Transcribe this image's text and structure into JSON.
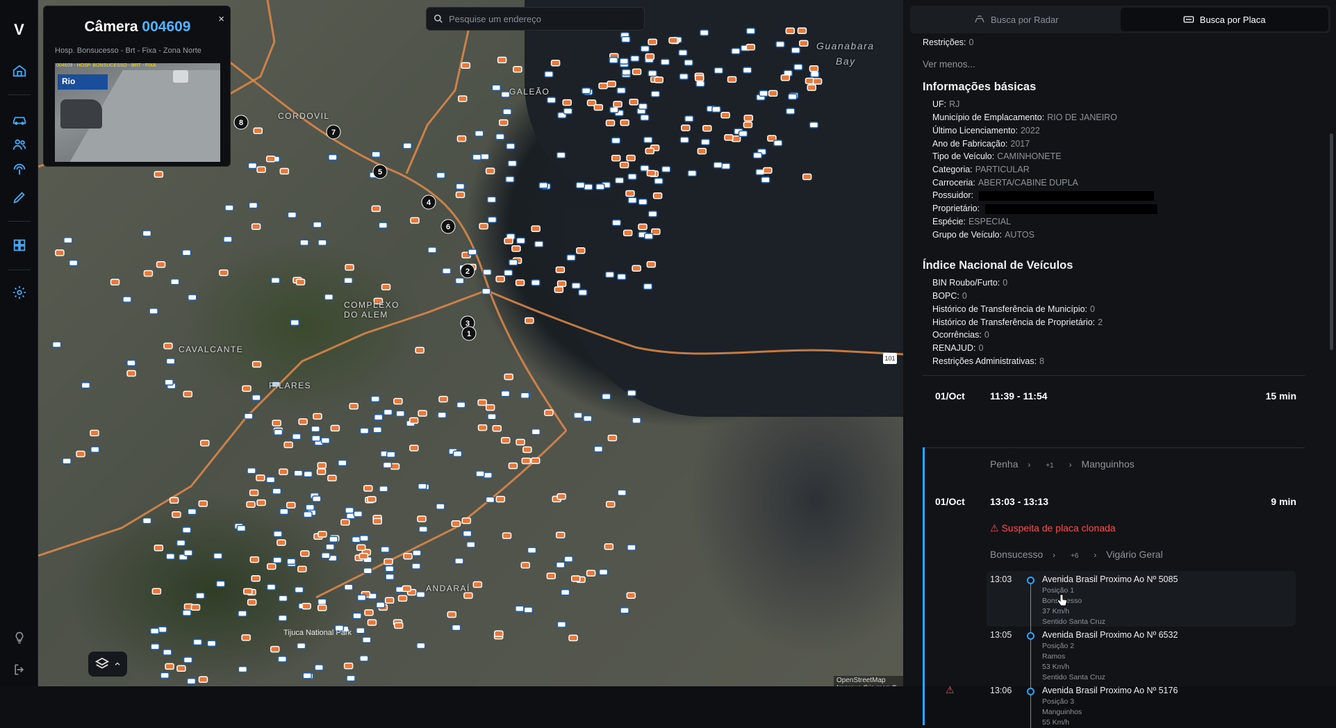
{
  "app": {
    "logo": "V"
  },
  "search": {
    "placeholder": "Pesquise um endereço"
  },
  "camera_card": {
    "title_prefix": "Câmera",
    "camera_id": "004609",
    "subtitle": "Hosp. Bonsucesso - Brt - Fixa - Zona Norte",
    "overlay_text": "004609 - HOSP. BONSUCESSO - BRT - FIXA",
    "logo_text": "Rio",
    "close_label": "×"
  },
  "map": {
    "labels": [
      "Guanabara",
      "Bay",
      "GALEÃO",
      "CORDOVIL",
      "COMPLEXO",
      "DO ALEM",
      "CAVALCANTE",
      "PILARES",
      "ANDARAÍ",
      "Tijuca National Park"
    ],
    "markers": [
      "8",
      "7",
      "5",
      "4",
      "6",
      "2",
      "3",
      "1"
    ],
    "highway_shield": "101",
    "attribution": "OpenStreetMap Improve this map © Maxar"
  },
  "tabs": [
    {
      "label": "Busca por Radar",
      "icon": "radar-icon",
      "active": false
    },
    {
      "label": "Busca por Placa",
      "icon": "plate-icon",
      "active": true
    }
  ],
  "panel": {
    "restricoes_top": {
      "key": "Restrições:",
      "value": "0"
    },
    "ver_menos": "Ver menos...",
    "basic_title": "Informações básicas",
    "basic": [
      {
        "key": "UF:",
        "value": "RJ"
      },
      {
        "key": "Município de Emplacamento:",
        "value": "RIO DE JANEIRO"
      },
      {
        "key": "Último Licenciamento:",
        "value": "2022"
      },
      {
        "key": "Ano de Fabricação:",
        "value": "2017"
      },
      {
        "key": "Tipo de Veículo:",
        "value": "CAMINHONETE"
      },
      {
        "key": "Categoria:",
        "value": "PARTICULAR"
      },
      {
        "key": "Carroceria:",
        "value": "ABERTA/CABINE DUPLA"
      },
      {
        "key": "Possuidor:",
        "value": ""
      },
      {
        "key": "Proprietário:",
        "value": ""
      },
      {
        "key": "Espécie:",
        "value": "ESPECIAL"
      },
      {
        "key": "Grupo de Veículo:",
        "value": "AUTOS"
      }
    ],
    "inv_title": "Índice Nacional de Veículos",
    "inv": [
      {
        "key": "BIN Roubo/Furto:",
        "value": "0"
      },
      {
        "key": "BOPC:",
        "value": "0"
      },
      {
        "key": "Histórico de Transferência de Município:",
        "value": "0"
      },
      {
        "key": "Histórico de Transferência de Proprietário:",
        "value": "2"
      },
      {
        "key": "Ocorrências:",
        "value": "0"
      },
      {
        "key": "RENAJUD:",
        "value": "0"
      },
      {
        "key": "Restrições Administrativas:",
        "value": "8"
      }
    ]
  },
  "trips": [
    {
      "date": "01/Oct",
      "time": "11:39 - 11:54",
      "duration": "15 min",
      "from": "Penha",
      "middle": "+1",
      "to": "Manguinhos"
    },
    {
      "date": "01/Oct",
      "time": "13:03 - 13:13",
      "duration": "9 min",
      "alert": "Suspeita de placa clonada",
      "from": "Bonsucesso",
      "middle": "+6",
      "to": "Vigário Geral",
      "stops": [
        {
          "time": "13:03",
          "title": "Avenida Brasil Proximo Ao Nº 5085",
          "position": "Posição 1",
          "area": "Bonsucesso",
          "speed": "37 Km/h",
          "direction": "Sentido Santa Cruz"
        },
        {
          "time": "13:05",
          "title": "Avenida Brasil Proximo Ao Nº 6532",
          "position": "Posição 2",
          "area": "Ramos",
          "speed": "53 Km/h",
          "direction": "Sentido Santa Cruz"
        },
        {
          "time": "13:06",
          "title": "Avenida Brasil Proximo Ao Nº 5176",
          "position": "Posição 3",
          "area": "Manguinhos",
          "speed": "55 Km/h",
          "direction": ""
        }
      ]
    }
  ],
  "colors": {
    "accent": "#2aa6ff",
    "alert": "#ff4b4b",
    "camera_marker": "#e8783a",
    "radar_marker": "#1f5fa8"
  }
}
